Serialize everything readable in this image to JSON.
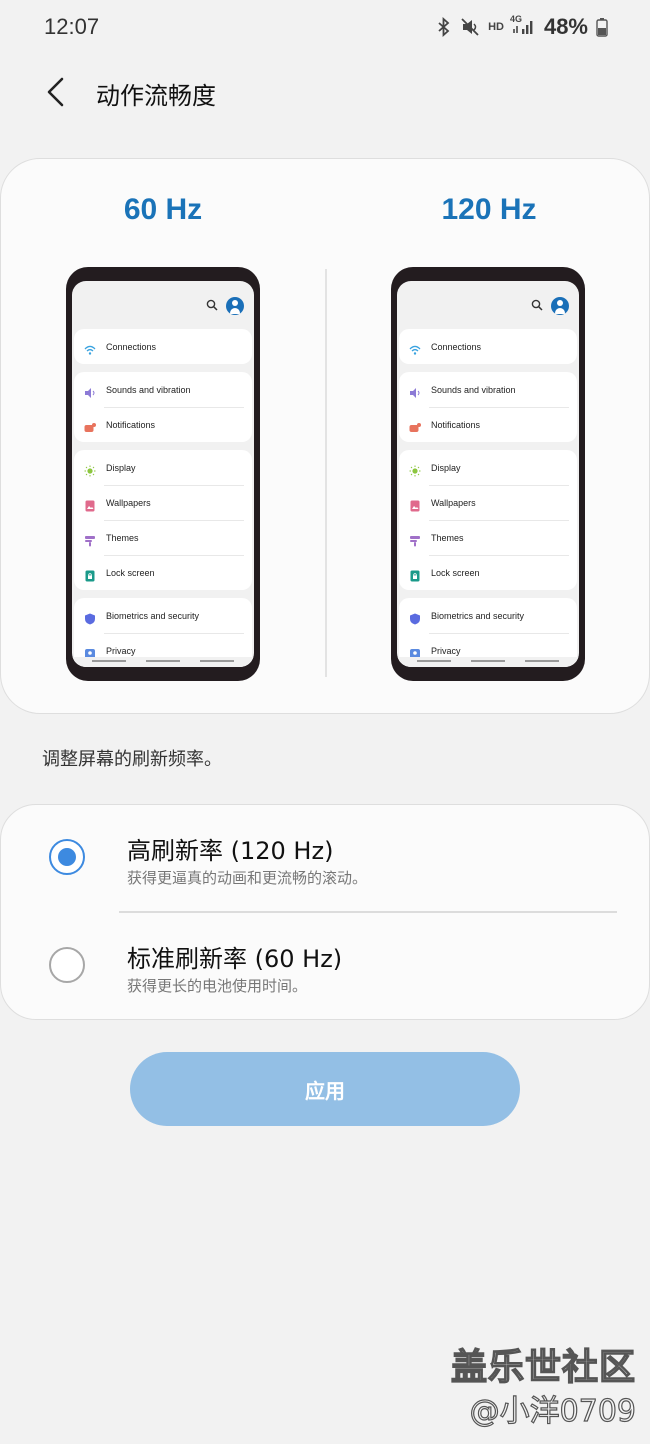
{
  "status_bar": {
    "time": "12:07",
    "network_hd": "HD",
    "network_4g": "4G",
    "battery": "48%"
  },
  "header": {
    "title": "动作流畅度"
  },
  "preview": {
    "left_label": "60 Hz",
    "right_label": "120 Hz",
    "groups": [
      [
        {
          "label": "Connections",
          "icon": "wifi-icon",
          "color": "#3aa3e0"
        }
      ],
      [
        {
          "label": "Sounds and vibration",
          "icon": "speaker-icon",
          "color": "#8c7ad6"
        },
        {
          "label": "Notifications",
          "icon": "notification-icon",
          "color": "#e8735d"
        }
      ],
      [
        {
          "label": "Display",
          "icon": "sun-icon",
          "color": "#8cc63f"
        },
        {
          "label": "Wallpapers",
          "icon": "wallpaper-icon",
          "color": "#e06a8c"
        },
        {
          "label": "Themes",
          "icon": "themes-icon",
          "color": "#a070c8"
        },
        {
          "label": "Lock screen",
          "icon": "lock-icon",
          "color": "#1a9a8a"
        }
      ],
      [
        {
          "label": "Biometrics and security",
          "icon": "shield-icon",
          "color": "#5a6be0"
        },
        {
          "label": "Privacy",
          "icon": "privacy-icon",
          "color": "#5a8ae0"
        }
      ]
    ]
  },
  "description": "调整屏幕的刷新频率。",
  "options": {
    "high": {
      "title": "高刷新率 (120 Hz)",
      "subtitle": "获得更逼真的动画和更流畅的滚动。",
      "selected": true
    },
    "standard": {
      "title": "标准刷新率 (60 Hz)",
      "subtitle": "获得更长的电池使用时间。",
      "selected": false
    }
  },
  "apply_label": "应用",
  "watermark": {
    "title": "盖乐世社区",
    "user": "@小洋0709"
  },
  "colors": {
    "accent": "#1a73b8",
    "radio_selected": "#3d8ae0",
    "apply_button": "#93bfe5"
  }
}
